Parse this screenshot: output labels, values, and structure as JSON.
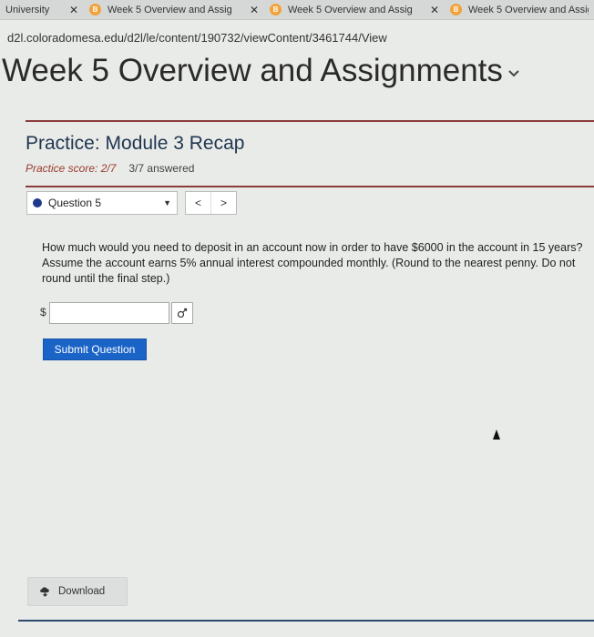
{
  "tabs": [
    {
      "label": "University",
      "close": "✕"
    },
    {
      "label": "Week 5 Overview and Assig",
      "close": "✕"
    },
    {
      "label": "Week 5 Overview and Assig",
      "close": "✕"
    },
    {
      "label": "Week 5 Overview and Assig",
      "close": ""
    }
  ],
  "url": "d2l.coloradomesa.edu/d2l/le/content/190732/viewContent/3461744/View",
  "page_title": "Week 5 Overview and Assignments",
  "practice": {
    "title": "Practice: Module 3 Recap",
    "score": "Practice score: 2/7",
    "answered": "3/7 answered"
  },
  "question_selector": {
    "selected": "Question 5",
    "prev": "<",
    "next": ">"
  },
  "question_text": "How much would you need to deposit in an account now in order to have $6000 in the account in 15 years? Assume the account earns 5% annual interest compounded monthly. (Round to the nearest penny. Do not round until the final step.)",
  "answer": {
    "prefix": "$",
    "value": ""
  },
  "submit_label": "Submit Question",
  "download_label": "Download",
  "colors": {
    "accent_blue": "#1a64c8",
    "rule": "#8b3b3b",
    "favicon": "#f2a23a"
  }
}
